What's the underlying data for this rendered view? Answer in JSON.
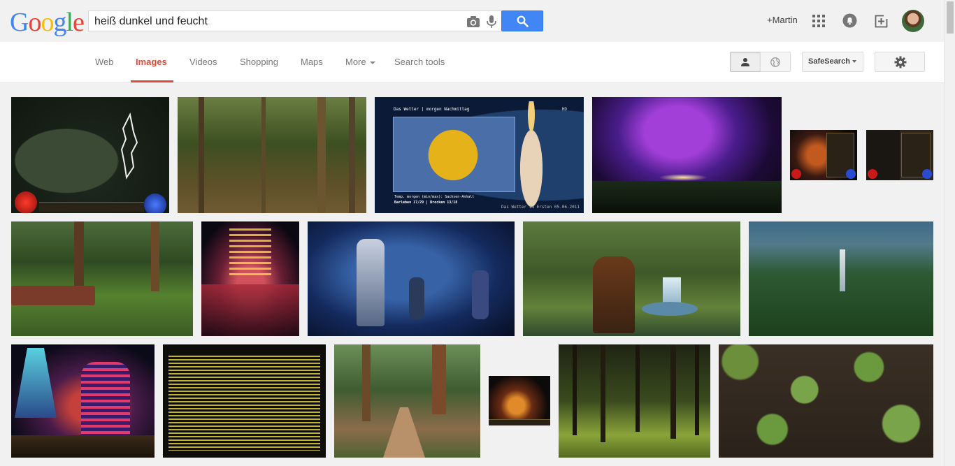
{
  "search": {
    "query": "heiß dunkel und feucht"
  },
  "header": {
    "logo_letters": [
      {
        "char": "G",
        "color": "#4285f4"
      },
      {
        "char": "o",
        "color": "#ea4335"
      },
      {
        "char": "o",
        "color": "#fbbc05"
      },
      {
        "char": "g",
        "color": "#4285f4"
      },
      {
        "char": "l",
        "color": "#34a853"
      },
      {
        "char": "e",
        "color": "#ea4335"
      }
    ],
    "user_link": "+Martin"
  },
  "nav": {
    "tabs": [
      {
        "label": "Web",
        "active": false
      },
      {
        "label": "Images",
        "active": true
      },
      {
        "label": "Videos",
        "active": false
      },
      {
        "label": "Shopping",
        "active": false
      },
      {
        "label": "Maps",
        "active": false
      },
      {
        "label": "More",
        "active": false
      },
      {
        "label": "Search tools",
        "active": false
      }
    ],
    "safesearch_label": "SafeSearch"
  },
  "images": {
    "weather_title": "Das Wetter | morgen Nachmittag",
    "weather_temp": "Temp. morgen (min/max): Sachsen-Anhalt",
    "weather_cities": "Barleben 17/29 | Brocken 13/18",
    "weather_footer": "Das Wetter im Ersten 05.06.2011",
    "weather_channel": "HD"
  },
  "colors": {
    "accent": "#dd4b39",
    "search_button": "#4285f4"
  }
}
